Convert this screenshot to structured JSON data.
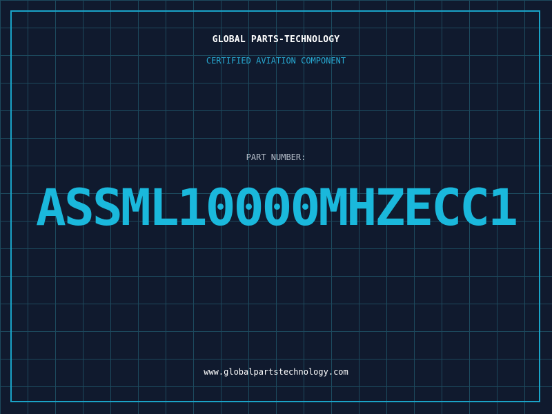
{
  "header": {
    "brand": "GLOBAL PARTS-TECHNOLOGY",
    "tagline": "CERTIFIED AVIATION COMPONENT"
  },
  "part": {
    "label": "PART NUMBER:",
    "number": "ASSML10000MHZECC1"
  },
  "footer": {
    "website": "www.globalpartstechnology.com"
  },
  "colors": {
    "background": "#101a2e",
    "grid": "#1d4a5e",
    "accent": "#1ab8dc",
    "frame": "#1aa3c7"
  }
}
